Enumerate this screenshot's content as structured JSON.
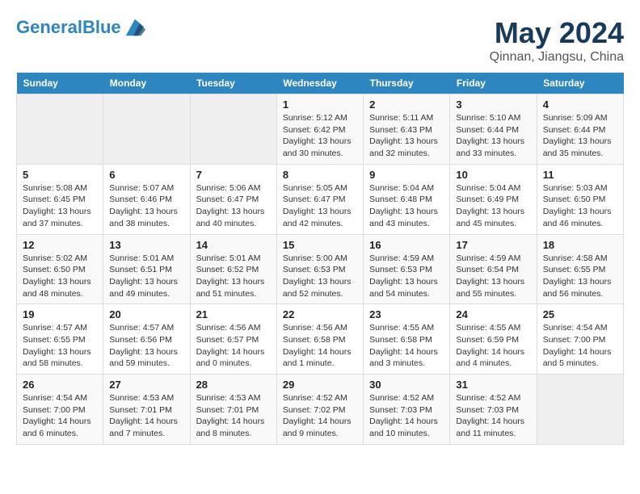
{
  "header": {
    "logo_line1": "General",
    "logo_line2": "Blue",
    "title": "May 2024",
    "subtitle": "Qinnan, Jiangsu, China"
  },
  "weekdays": [
    "Sunday",
    "Monday",
    "Tuesday",
    "Wednesday",
    "Thursday",
    "Friday",
    "Saturday"
  ],
  "weeks": [
    [
      {
        "day": "",
        "info": ""
      },
      {
        "day": "",
        "info": ""
      },
      {
        "day": "",
        "info": ""
      },
      {
        "day": "1",
        "info": "Sunrise: 5:12 AM\nSunset: 6:42 PM\nDaylight: 13 hours\nand 30 minutes."
      },
      {
        "day": "2",
        "info": "Sunrise: 5:11 AM\nSunset: 6:43 PM\nDaylight: 13 hours\nand 32 minutes."
      },
      {
        "day": "3",
        "info": "Sunrise: 5:10 AM\nSunset: 6:44 PM\nDaylight: 13 hours\nand 33 minutes."
      },
      {
        "day": "4",
        "info": "Sunrise: 5:09 AM\nSunset: 6:44 PM\nDaylight: 13 hours\nand 35 minutes."
      }
    ],
    [
      {
        "day": "5",
        "info": "Sunrise: 5:08 AM\nSunset: 6:45 PM\nDaylight: 13 hours\nand 37 minutes."
      },
      {
        "day": "6",
        "info": "Sunrise: 5:07 AM\nSunset: 6:46 PM\nDaylight: 13 hours\nand 38 minutes."
      },
      {
        "day": "7",
        "info": "Sunrise: 5:06 AM\nSunset: 6:47 PM\nDaylight: 13 hours\nand 40 minutes."
      },
      {
        "day": "8",
        "info": "Sunrise: 5:05 AM\nSunset: 6:47 PM\nDaylight: 13 hours\nand 42 minutes."
      },
      {
        "day": "9",
        "info": "Sunrise: 5:04 AM\nSunset: 6:48 PM\nDaylight: 13 hours\nand 43 minutes."
      },
      {
        "day": "10",
        "info": "Sunrise: 5:04 AM\nSunset: 6:49 PM\nDaylight: 13 hours\nand 45 minutes."
      },
      {
        "day": "11",
        "info": "Sunrise: 5:03 AM\nSunset: 6:50 PM\nDaylight: 13 hours\nand 46 minutes."
      }
    ],
    [
      {
        "day": "12",
        "info": "Sunrise: 5:02 AM\nSunset: 6:50 PM\nDaylight: 13 hours\nand 48 minutes."
      },
      {
        "day": "13",
        "info": "Sunrise: 5:01 AM\nSunset: 6:51 PM\nDaylight: 13 hours\nand 49 minutes."
      },
      {
        "day": "14",
        "info": "Sunrise: 5:01 AM\nSunset: 6:52 PM\nDaylight: 13 hours\nand 51 minutes."
      },
      {
        "day": "15",
        "info": "Sunrise: 5:00 AM\nSunset: 6:53 PM\nDaylight: 13 hours\nand 52 minutes."
      },
      {
        "day": "16",
        "info": "Sunrise: 4:59 AM\nSunset: 6:53 PM\nDaylight: 13 hours\nand 54 minutes."
      },
      {
        "day": "17",
        "info": "Sunrise: 4:59 AM\nSunset: 6:54 PM\nDaylight: 13 hours\nand 55 minutes."
      },
      {
        "day": "18",
        "info": "Sunrise: 4:58 AM\nSunset: 6:55 PM\nDaylight: 13 hours\nand 56 minutes."
      }
    ],
    [
      {
        "day": "19",
        "info": "Sunrise: 4:57 AM\nSunset: 6:55 PM\nDaylight: 13 hours\nand 58 minutes."
      },
      {
        "day": "20",
        "info": "Sunrise: 4:57 AM\nSunset: 6:56 PM\nDaylight: 13 hours\nand 59 minutes."
      },
      {
        "day": "21",
        "info": "Sunrise: 4:56 AM\nSunset: 6:57 PM\nDaylight: 14 hours\nand 0 minutes."
      },
      {
        "day": "22",
        "info": "Sunrise: 4:56 AM\nSunset: 6:58 PM\nDaylight: 14 hours\nand 1 minute."
      },
      {
        "day": "23",
        "info": "Sunrise: 4:55 AM\nSunset: 6:58 PM\nDaylight: 14 hours\nand 3 minutes."
      },
      {
        "day": "24",
        "info": "Sunrise: 4:55 AM\nSunset: 6:59 PM\nDaylight: 14 hours\nand 4 minutes."
      },
      {
        "day": "25",
        "info": "Sunrise: 4:54 AM\nSunset: 7:00 PM\nDaylight: 14 hours\nand 5 minutes."
      }
    ],
    [
      {
        "day": "26",
        "info": "Sunrise: 4:54 AM\nSunset: 7:00 PM\nDaylight: 14 hours\nand 6 minutes."
      },
      {
        "day": "27",
        "info": "Sunrise: 4:53 AM\nSunset: 7:01 PM\nDaylight: 14 hours\nand 7 minutes."
      },
      {
        "day": "28",
        "info": "Sunrise: 4:53 AM\nSunset: 7:01 PM\nDaylight: 14 hours\nand 8 minutes."
      },
      {
        "day": "29",
        "info": "Sunrise: 4:52 AM\nSunset: 7:02 PM\nDaylight: 14 hours\nand 9 minutes."
      },
      {
        "day": "30",
        "info": "Sunrise: 4:52 AM\nSunset: 7:03 PM\nDaylight: 14 hours\nand 10 minutes."
      },
      {
        "day": "31",
        "info": "Sunrise: 4:52 AM\nSunset: 7:03 PM\nDaylight: 14 hours\nand 11 minutes."
      },
      {
        "day": "",
        "info": ""
      }
    ]
  ]
}
